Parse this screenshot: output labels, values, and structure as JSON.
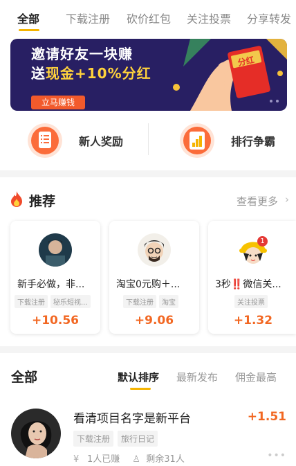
{
  "tabs": [
    "全部",
    "下载注册",
    "砍价红包",
    "关注投票",
    "分享转发"
  ],
  "banner": {
    "line1": "邀请好友一块赚",
    "line2_prefix": "送",
    "line2_highlight": "现金+10%分红",
    "button": "立马赚钱",
    "envelope_text": "分红"
  },
  "quick": [
    {
      "label": "新人奖励",
      "icon": "document-icon"
    },
    {
      "label": "排行争霸",
      "icon": "ranking-chart-icon"
    }
  ],
  "recommend": {
    "title": "推荐",
    "more": "查看更多",
    "cards": [
      {
        "title": "新手必做，非...",
        "tags": [
          "下载注册",
          "秘乐短视..."
        ],
        "price": "+10.56"
      },
      {
        "title": "淘宝0元购＋...",
        "tags": [
          "下载注册",
          "淘宝"
        ],
        "price": "+9.06"
      },
      {
        "title": "3秒‼️微信关...",
        "tags": [
          "关注投票"
        ],
        "price": "+1.32",
        "badge": "1"
      }
    ]
  },
  "list": {
    "title": "全部",
    "sorts": [
      "默认排序",
      "最新发布",
      "佣金最高"
    ],
    "items": [
      {
        "title": "看清项目名字是新平台",
        "price": "+1.51",
        "tags": [
          "下载注册",
          "旅行日记"
        ],
        "earned": "1人已赚",
        "remaining": "剩余31人"
      }
    ]
  },
  "colors": {
    "accent": "#f5b400",
    "price": "#f26722",
    "banner_bg": "#281f63"
  }
}
